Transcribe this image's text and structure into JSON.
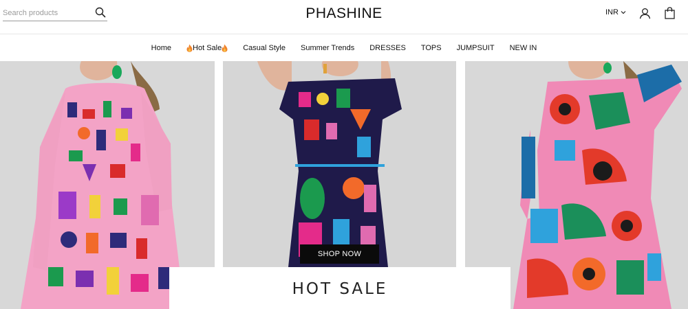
{
  "header": {
    "search": {
      "placeholder": "Search products",
      "value": "",
      "icon": "search-icon"
    },
    "logo": "PHASHINE",
    "currency": "INR",
    "icons": {
      "account": "user-icon",
      "cart": "bag-icon"
    }
  },
  "nav": {
    "items": [
      {
        "label": "Home"
      },
      {
        "label": "Hot Sale",
        "icon": "flame-icon"
      },
      {
        "label": "Casual Style"
      },
      {
        "label": "Summer Trends"
      },
      {
        "label": "DRESSES"
      },
      {
        "label": "TOPS"
      },
      {
        "label": "JUMPSUIT"
      },
      {
        "label": "NEW IN"
      }
    ]
  },
  "hero": {
    "cta": "SHOP NOW",
    "caption": "HOT SALE"
  },
  "colors": {
    "accent": "#0b0b0b",
    "background": "#ffffff",
    "photo_bg": "#d9d9d9",
    "flame": "#f0842c"
  }
}
